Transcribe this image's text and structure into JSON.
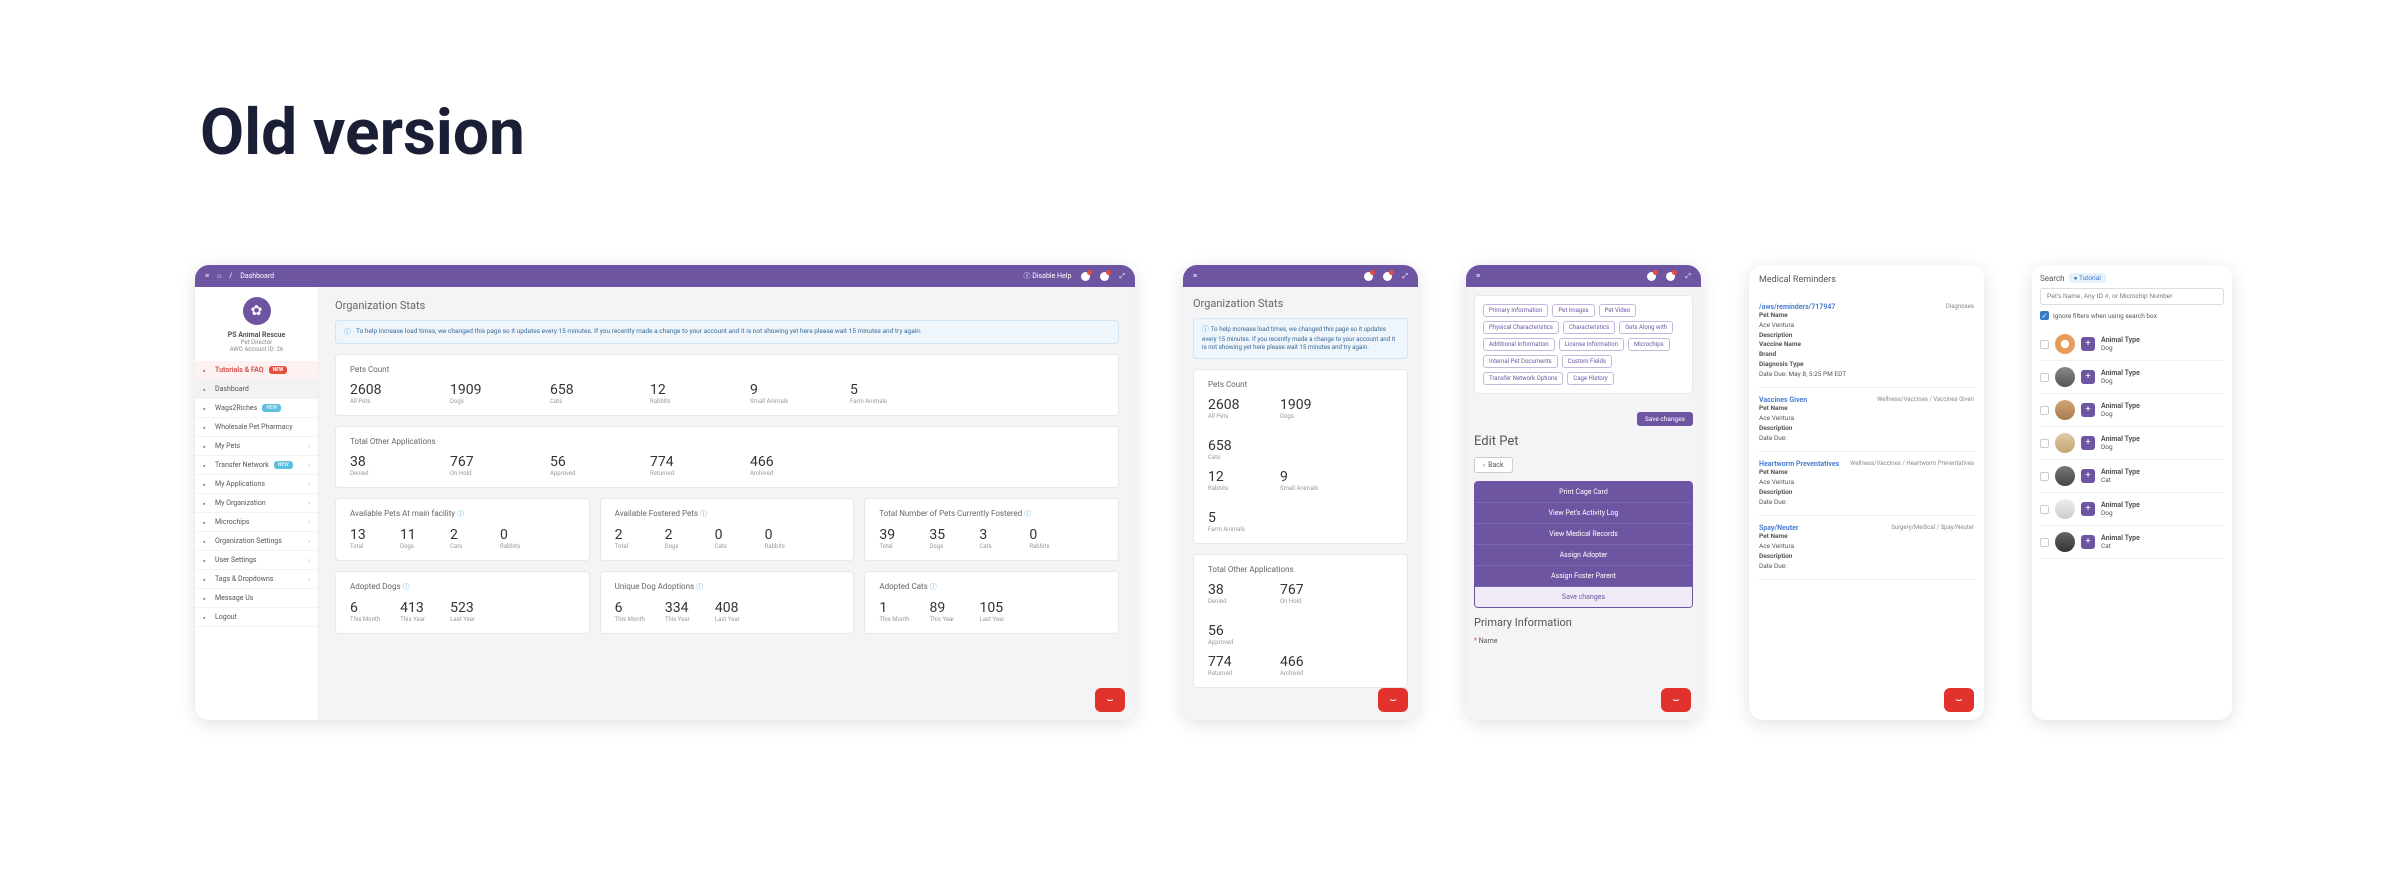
{
  "page_title": "Old version",
  "colors": {
    "brand": "#6e55a2",
    "accent_red": "#e2322d",
    "info_blue": "#4aa3df"
  },
  "shot1": {
    "topbar": {
      "breadcrumb_home": "⌂",
      "breadcrumb_sep": "/",
      "breadcrumb_page": "Dashboard",
      "disable_help": "Ⓘ Disable Help"
    },
    "sidebar": {
      "org_name": "PS Animal Rescue",
      "role": "Pet Director",
      "acct": "AWO Account ID: 26",
      "items": [
        {
          "label": "Tutorials & FAQ",
          "badge": "NEW",
          "hl": true
        },
        {
          "label": "Dashboard",
          "active": true
        },
        {
          "label": "Wags2Riches",
          "badge_blue": "NEW"
        },
        {
          "label": "Wholesale Pet Pharmacy"
        },
        {
          "label": "My Pets",
          "caret": true
        },
        {
          "label": "Transfer Network",
          "badge_blue": "NEW",
          "caret": true
        },
        {
          "label": "My Applications",
          "caret": true
        },
        {
          "label": "My Organization",
          "caret": true
        },
        {
          "label": "Microchips",
          "caret": true
        },
        {
          "label": "Organization Settings",
          "caret": true
        },
        {
          "label": "User Settings",
          "caret": true
        },
        {
          "label": "Tags & Dropdowns",
          "caret": true
        },
        {
          "label": "Message Us"
        },
        {
          "label": "Logout"
        }
      ]
    },
    "main": {
      "section_title": "Organization Stats",
      "notice": "To help increase load times, we changed this page so it updates every 15 minutes. If you recently made a change to your account and it is not showing yet here please wait 15 minutes and try again.",
      "pets_count": {
        "title": "Pets Count",
        "stats": [
          {
            "num": "2608",
            "lbl": "All Pets"
          },
          {
            "num": "1909",
            "lbl": "Dogs"
          },
          {
            "num": "658",
            "lbl": "Cats"
          },
          {
            "num": "12",
            "lbl": "Rabbits"
          },
          {
            "num": "9",
            "lbl": "Small Animals"
          },
          {
            "num": "5",
            "lbl": "Farm Animals"
          }
        ]
      },
      "other_apps": {
        "title": "Total Other Applications",
        "stats": [
          {
            "num": "38",
            "lbl": "Denied"
          },
          {
            "num": "767",
            "lbl": "On Hold"
          },
          {
            "num": "56",
            "lbl": "Approved"
          },
          {
            "num": "774",
            "lbl": "Returned"
          },
          {
            "num": "466",
            "lbl": "Archived"
          }
        ]
      },
      "triple": [
        {
          "title": "Available Pets At main facility",
          "stats": [
            {
              "num": "13",
              "lbl": "Total"
            },
            {
              "num": "11",
              "lbl": "Dogs"
            },
            {
              "num": "2",
              "lbl": "Cats"
            },
            {
              "num": "0",
              "lbl": "Rabbits"
            }
          ]
        },
        {
          "title": "Available Fostered Pets",
          "stats": [
            {
              "num": "2",
              "lbl": "Total"
            },
            {
              "num": "2",
              "lbl": "Dogs"
            },
            {
              "num": "0",
              "lbl": "Cats"
            },
            {
              "num": "0",
              "lbl": "Rabbits"
            }
          ]
        },
        {
          "title": "Total Number of Pets Currently Fostered",
          "stats": [
            {
              "num": "39",
              "lbl": "Total"
            },
            {
              "num": "35",
              "lbl": "Dogs"
            },
            {
              "num": "3",
              "lbl": "Cats"
            },
            {
              "num": "0",
              "lbl": "Rabbits"
            }
          ]
        }
      ],
      "triple2": [
        {
          "title": "Adopted Dogs",
          "stats": [
            {
              "num": "6",
              "lbl": "This Month"
            },
            {
              "num": "413",
              "lbl": "This Year"
            },
            {
              "num": "523",
              "lbl": "Last Year"
            }
          ]
        },
        {
          "title": "Unique Dog Adoptions",
          "stats": [
            {
              "num": "6",
              "lbl": "This Month"
            },
            {
              "num": "334",
              "lbl": "This Year"
            },
            {
              "num": "408",
              "lbl": "Last Year"
            }
          ]
        },
        {
          "title": "Adopted Cats",
          "stats": [
            {
              "num": "1",
              "lbl": "This Month"
            },
            {
              "num": "89",
              "lbl": "This Year"
            },
            {
              "num": "105",
              "lbl": "Last Year"
            }
          ]
        }
      ]
    }
  },
  "shot2": {
    "section_title": "Organization Stats",
    "notice": "To help increase load times, we changed this page so it updates every 15 minutes. If you recently made a change to your account and it is not showing yet here please wait 15 minutes and try again.",
    "pets_count": {
      "title": "Pets Count",
      "row1": [
        {
          "num": "2608",
          "lbl": "All Pets"
        },
        {
          "num": "1909",
          "lbl": "Dogs"
        },
        {
          "num": "658",
          "lbl": "Cats"
        }
      ],
      "row2": [
        {
          "num": "12",
          "lbl": "Rabbits"
        },
        {
          "num": "9",
          "lbl": "Small Animals"
        },
        {
          "num": "5",
          "lbl": "Farm Animals"
        }
      ]
    },
    "other_apps": {
      "title": "Total Other Applications",
      "row1": [
        {
          "num": "38",
          "lbl": "Denied"
        },
        {
          "num": "767",
          "lbl": "On Hold"
        },
        {
          "num": "56",
          "lbl": "Approved"
        }
      ],
      "row2": [
        {
          "num": "774",
          "lbl": "Returned"
        },
        {
          "num": "466",
          "lbl": "Archived"
        }
      ]
    }
  },
  "shot3": {
    "chips": [
      "Primary Information",
      "Pet Images",
      "Pet Video",
      "Physical Characteristics",
      "Characteristics",
      "Gets Along with",
      "Additional Information",
      "License Information",
      "Microchips",
      "Internal Pet Documents",
      "Custom Fields",
      "Transfer Network Options",
      "Cage History"
    ],
    "save_changes": "Save changes",
    "title": "Edit Pet",
    "back": "Back",
    "actions": [
      "Print Cage Card",
      "View Pet's Activity Log",
      "View Medical Records",
      "Assign Adopter",
      "Assign Foster Parent",
      "Save changes"
    ],
    "primary_info": "Primary Information",
    "name_label": "Name"
  },
  "shot4": {
    "title": "Medical Reminders",
    "blocks": [
      {
        "link": "/aws/reminders/717947",
        "tag": "Diagnoses",
        "rows": [
          {
            "k": "Pet Name",
            "v": "Ace Ventura"
          },
          {
            "k": "Description",
            "v": ""
          },
          {
            "k": "Vaccine Name",
            "v": ""
          },
          {
            "k": "Brand",
            "v": ""
          },
          {
            "k": "Diagnosis Type",
            "v": ""
          }
        ],
        "date": "Date Due: May 8, 5:25 PM EDT"
      },
      {
        "link": "Vaccines Given",
        "tag": "Wellness/Vaccines / Vaccines Given",
        "rows": [
          {
            "k": "Pet Name",
            "v": "Ace Ventura"
          },
          {
            "k": "Description",
            "v": ""
          }
        ],
        "date": "Date Due:"
      },
      {
        "link": "Heartworm Preventatives",
        "tag": "Wellness/Vaccines / Heartworm Preventatives",
        "rows": [
          {
            "k": "Pet Name",
            "v": "Ace Ventura"
          },
          {
            "k": "Description",
            "v": ""
          }
        ],
        "date": "Date Due:"
      },
      {
        "link": "Spay/Neuter",
        "tag": "Surgery/Medical / Spay/Neuter",
        "rows": [
          {
            "k": "Pet Name",
            "v": "Ace Ventura"
          },
          {
            "k": "Description",
            "v": ""
          }
        ],
        "date": "Date Due:"
      }
    ]
  },
  "shot5": {
    "search_label": "Search",
    "tutorial_badge": "Tutorial",
    "placeholder": "Pet's Name, Any ID #, or Microchip Number",
    "ignore_filters": "Ignore filters when using search box",
    "rows": [
      {
        "type_label": "Animal Type",
        "type": "Dog",
        "avatar": "a1"
      },
      {
        "type_label": "Animal Type",
        "type": "Dog",
        "avatar": "a2"
      },
      {
        "type_label": "Animal Type",
        "type": "Dog",
        "avatar": "a3"
      },
      {
        "type_label": "Animal Type",
        "type": "Dog",
        "avatar": "a4"
      },
      {
        "type_label": "Animal Type",
        "type": "Cat",
        "avatar": "a5"
      },
      {
        "type_label": "Animal Type",
        "type": "Dog",
        "avatar": "a6"
      },
      {
        "type_label": "Animal Type",
        "type": "Cat",
        "avatar": "a7"
      }
    ]
  }
}
